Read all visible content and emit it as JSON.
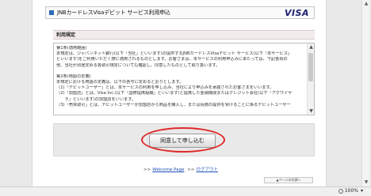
{
  "header": {
    "title": "JNBカードレスVisaデビット サービス利用申込",
    "brand": "VISA"
  },
  "section": {
    "title": "利用規定"
  },
  "terms": {
    "lines": [
      "第1条(適用範囲)",
      "本規定は、ジャパンネット銀行(以下「当社」といいます)の提供するJNBカードレスVisaデビット サービス(以下「本サービス」",
      "といいます)をご利用いただく際に適用されるものとします。お客さまは、本サービスの利用申込みにあたっては、下記各項の",
      "他、当社が別途定める各取引規定についても確認し、同意したものとして取り扱います。",
      "",
      "第2条(用語の定義)",
      "本規定における用語の定義は、以下の各号に定めるとおりとします。",
      "（1)「デビットユーザー」とは、本サービスの利用を申し込み、当社により申込みを承諾されたお客さまをいいます。",
      "（2)「加盟店」とは、Visa Inc.(以下「国際提携組織」といいます)と提携した金融機関またはクレジット会社(以下「アクワイヤ",
      "　　ラ」といいます)の加盟店をいいます。",
      "（3)「売買取引」とは、デビットユーザーが加盟店から商品を購入し、または役務の提供を受けることに係るデビットユーザー"
    ]
  },
  "actions": {
    "agree_label": "同意して申し込む"
  },
  "links": {
    "welcome_label": "Welcome Page",
    "logout_label": "ログアウト",
    "top_label": "ページの先頭へ"
  },
  "status": {
    "zoom": "100%"
  }
}
